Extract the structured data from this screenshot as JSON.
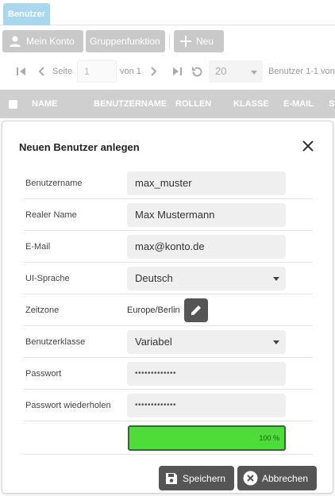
{
  "tabs": [
    {
      "label": "Benutzer",
      "active": true
    }
  ],
  "toolbar": {
    "my_account_label": "Mein Konto",
    "group_function_label": "Gruppenfunktion",
    "new_label": "Neu"
  },
  "pager": {
    "page_label": "Seite",
    "page_value": "1",
    "of_label": "von 1",
    "page_size": "20",
    "summary": "Benutzer 1-1 von"
  },
  "table": {
    "columns": [
      "NAME",
      "BENUTZERNAME",
      "ROLLEN",
      "KLASSE",
      "E-MAIL",
      "S"
    ]
  },
  "dialog": {
    "title": "Neuen Benutzer anlegen",
    "fields": {
      "username": {
        "label": "Benutzername",
        "value": "max_muster"
      },
      "realname": {
        "label": "Realer Name",
        "value": "Max Mustermann"
      },
      "email": {
        "label": "E-Mail",
        "value": "max@konto.de"
      },
      "language": {
        "label": "UI-Sprache",
        "value": "Deutsch"
      },
      "timezone": {
        "label": "Zeitzone",
        "value": "Europe/Berlin"
      },
      "userclass": {
        "label": "Benutzerklasse",
        "value": "Variabel"
      },
      "password": {
        "label": "Passwort",
        "value": "•••••••••••••"
      },
      "password_repeat": {
        "label": "Passwort wiederholen",
        "value": "•••••••••••••"
      }
    },
    "strength": {
      "percent": 100,
      "label": "100 %"
    },
    "save_label": "Speichern",
    "cancel_label": "Abbrechen"
  },
  "colors": {
    "tab_active": "#a8d8f0",
    "toolbar_button": "#c9c9c9",
    "header_bg": "#cfcfcf",
    "dialog_button": "#555555",
    "strength_fill": "#4ddc38"
  }
}
